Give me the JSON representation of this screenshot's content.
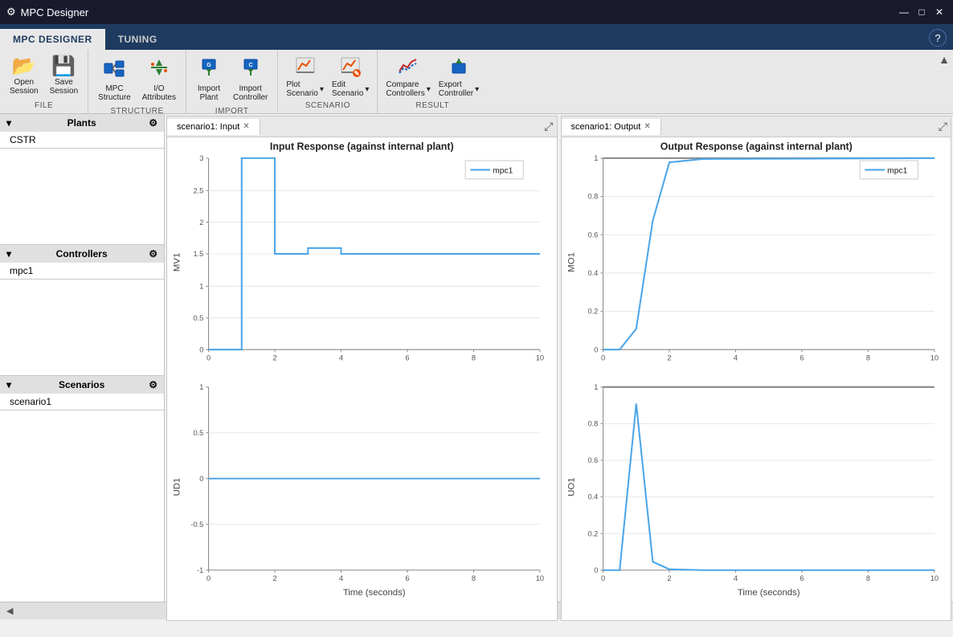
{
  "titleBar": {
    "icon": "⚙",
    "title": "MPC Designer",
    "minimizeLabel": "—",
    "maximizeLabel": "□",
    "closeLabel": "✕"
  },
  "appTabs": [
    {
      "id": "mpc-designer",
      "label": "MPC DESIGNER",
      "active": true
    },
    {
      "id": "tuning",
      "label": "TUNING",
      "active": false
    }
  ],
  "helpBtn": "?",
  "ribbon": {
    "groups": [
      {
        "id": "file",
        "label": "FILE",
        "buttons": [
          {
            "id": "open-session",
            "icon": "📂",
            "label": "Open\nSession"
          },
          {
            "id": "save-session",
            "icon": "💾",
            "label": "Save\nSession"
          }
        ]
      },
      {
        "id": "structure",
        "label": "STRUCTURE",
        "buttons": [
          {
            "id": "mpc-structure",
            "icon": "🔧",
            "label": "MPC\nStructure"
          },
          {
            "id": "io-attributes",
            "icon": "⚡",
            "label": "I/O\nAttributes"
          }
        ]
      },
      {
        "id": "import",
        "label": "IMPORT",
        "buttons": [
          {
            "id": "import-plant",
            "icon": "⬇",
            "label": "Import\nPlant"
          },
          {
            "id": "import-controller",
            "icon": "⬇",
            "label": "Import\nController"
          }
        ]
      },
      {
        "id": "scenario",
        "label": "SCENARIO",
        "buttons": [
          {
            "id": "plot-scenario",
            "icon": "📈",
            "label": "Plot\nScenario",
            "hasArrow": true
          },
          {
            "id": "edit-scenario",
            "icon": "✏",
            "label": "Edit\nScenario",
            "hasArrow": true
          }
        ]
      },
      {
        "id": "result",
        "label": "RESULT",
        "buttons": [
          {
            "id": "compare-controllers",
            "icon": "📊",
            "label": "Compare\nControllers",
            "hasArrow": true
          },
          {
            "id": "export-controller",
            "icon": "⬆",
            "label": "Export\nController",
            "hasArrow": true
          }
        ]
      }
    ]
  },
  "sidebar": {
    "sections": [
      {
        "id": "plants",
        "label": "Plants",
        "items": [
          "CSTR"
        ]
      },
      {
        "id": "controllers",
        "label": "Controllers",
        "items": [
          "mpc1"
        ]
      },
      {
        "id": "scenarios",
        "label": "Scenarios",
        "items": [
          "scenario1"
        ]
      }
    ]
  },
  "panels": [
    {
      "id": "input-panel",
      "tab": "scenario1: Input",
      "active": true
    },
    {
      "id": "output-panel",
      "tab": "scenario1: Output",
      "active": true
    }
  ],
  "inputChart": {
    "title": "Input Response (against internal plant)",
    "legend": "mpc1",
    "topPlot": {
      "yLabel": "MV1",
      "yMin": 0,
      "yMax": 3,
      "yTicks": [
        0,
        0.5,
        1,
        1.5,
        2,
        2.5,
        3
      ]
    },
    "bottomPlot": {
      "yLabel": "UD1",
      "yMin": -1,
      "yMax": 1,
      "yTicks": [
        -1,
        -0.5,
        0,
        0.5,
        1
      ]
    },
    "xLabel": "Time (seconds)",
    "xMin": 0,
    "xMax": 10,
    "xTicks": [
      0,
      2,
      4,
      6,
      8,
      10
    ]
  },
  "outputChart": {
    "title": "Output Response (against internal plant)",
    "legend": "mpc1",
    "topPlot": {
      "yLabel": "MO1",
      "yMin": 0,
      "yMax": 1,
      "yTicks": [
        0,
        0.2,
        0.4,
        0.6,
        0.8,
        1
      ]
    },
    "bottomPlot": {
      "yLabel": "UO1",
      "yMin": 0,
      "yMax": 1,
      "yTicks": [
        0,
        0.2,
        0.4,
        0.6,
        0.8,
        1
      ]
    },
    "xLabel": "Time (seconds)",
    "xMin": 0,
    "xMax": 10,
    "xTicks": [
      0,
      2,
      4,
      6,
      8,
      10
    ]
  },
  "statusBar": {
    "scrollLeft": "◀",
    "text": ""
  }
}
